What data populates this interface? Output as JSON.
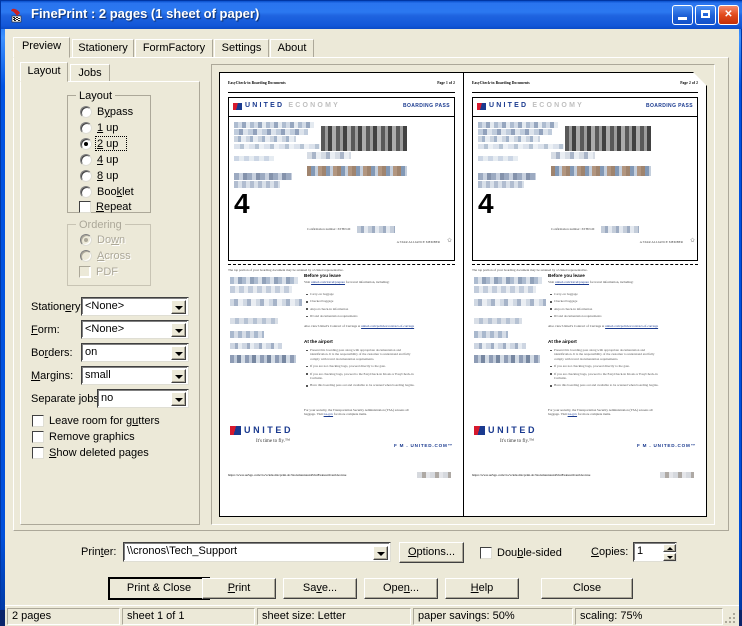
{
  "window": {
    "title": "FinePrint : 2 pages (1 sheet of paper)",
    "icon": "fineprint-icon",
    "minimize_label": "Minimize",
    "maximize_label": "Maximize",
    "close_label": "Close"
  },
  "tabs": [
    {
      "label": "Preview",
      "selected": true
    },
    {
      "label": "Stationery",
      "selected": false
    },
    {
      "label": "FormFactory",
      "selected": false
    },
    {
      "label": "Settings",
      "selected": false
    },
    {
      "label": "About",
      "selected": false
    }
  ],
  "subtabs": [
    {
      "label": "Layout",
      "selected": true
    },
    {
      "label": "Jobs",
      "selected": false
    }
  ],
  "layout_group": {
    "title": "Layout",
    "options": [
      {
        "label": "Bypass",
        "accel": "y",
        "selected": false
      },
      {
        "label": "1 up",
        "accel": "1",
        "selected": false
      },
      {
        "label": "2 up",
        "accel": "2",
        "selected": true,
        "focused": true
      },
      {
        "label": "4 up",
        "accel": "4",
        "selected": false
      },
      {
        "label": "8 up",
        "accel": "8",
        "selected": false
      },
      {
        "label": "Booklet",
        "accel": "k",
        "selected": false
      }
    ],
    "repeat": {
      "label": "Repeat",
      "accel": "R",
      "checked": false
    }
  },
  "ordering_group": {
    "title": "Ordering",
    "enabled": false,
    "options": [
      {
        "label": "Down",
        "accel": "w",
        "selected": true
      },
      {
        "label": "Across",
        "accel": "A",
        "selected": false
      }
    ],
    "pdf": {
      "label": "PDF",
      "checked": false
    }
  },
  "fields": [
    {
      "label": "Stationery:",
      "accel": "e",
      "value": "<None>",
      "name": "stationery-combo"
    },
    {
      "label": "Form:",
      "accel": "F",
      "value": "<None>",
      "name": "form-combo"
    },
    {
      "label": "Borders:",
      "accel": "r",
      "value": "on",
      "name": "borders-combo"
    },
    {
      "label": "Margins:",
      "accel": "M",
      "value": "small",
      "name": "margins-combo"
    },
    {
      "label": "Separate jobs:",
      "accel": "j",
      "value": "no",
      "name": "separate-jobs-combo"
    }
  ],
  "checkboxes": [
    {
      "label": "Leave room for gutters",
      "accel": "t",
      "checked": false,
      "name": "leave-room-for-gutters-checkbox"
    },
    {
      "label": "Remove graphics",
      "accel": "g",
      "checked": false,
      "name": "remove-graphics-checkbox"
    },
    {
      "label": "Show deleted pages",
      "accel": "S",
      "checked": false,
      "name": "show-deleted-pages-checkbox"
    }
  ],
  "printer": {
    "label": "Printer:",
    "accel": "t",
    "value": "\\\\cronos\\Tech_Support",
    "options_label": "Options...",
    "options_accel": "O",
    "double_sided": {
      "label": "Double-sided",
      "accel": "b",
      "checked": false
    },
    "copies_label": "Copies:",
    "copies_accel": "C",
    "copies_value": "1"
  },
  "buttons": [
    {
      "label": "Print & Close",
      "default": true,
      "name": "print-and-close-button"
    },
    {
      "label": "Print",
      "accel": "P",
      "default": false,
      "name": "print-button"
    },
    {
      "label": "Save...",
      "accel": "v",
      "default": false,
      "name": "save-button"
    },
    {
      "label": "Open...",
      "accel": "n",
      "default": false,
      "name": "open-button"
    },
    {
      "label": "Help",
      "accel": "H",
      "default": false,
      "name": "help-button"
    },
    {
      "label": "Close",
      "default": false,
      "name": "close-button"
    }
  ],
  "statusbar": [
    {
      "text": "2 pages",
      "name": "status-pages"
    },
    {
      "text": "sheet 1 of 1",
      "name": "status-sheet"
    },
    {
      "text": "sheet size: Letter",
      "name": "status-sheet-size"
    },
    {
      "text": "paper savings: 50%",
      "name": "status-paper-savings"
    },
    {
      "text": "scaling: 75%",
      "name": "status-scaling"
    }
  ],
  "preview_page": {
    "header_left": "EasyCheck-in Boarding Documents",
    "header_right": "Page 1 of 2",
    "brand": "UNITED",
    "brand_sub": "ECONOMY",
    "boarding_pass_tag": "BOARDING PASS",
    "big_number": "4",
    "confirmation": "Confirmation number: XTHJLM",
    "star_alliance": "A STAR ALLIANCE MEMBER",
    "detach_note": "The top portion of your boarding document may be retained by a United representative.",
    "section1_title": "Before you leave",
    "section1_intro": "Visit united.com/travel/prepare for travel information, including:",
    "section1_items": [
      "Carry-on baggage",
      "Checked baggage",
      "Airport check-in information",
      "ID and documentation requirements"
    ],
    "section1_note": "Also view United's Contract of Carriage at united.com/policies/contract-of-carriage",
    "section2_title": "At the airport",
    "section2_items": [
      "Present this boarding pass along with appropriate documentation and identification. It is the responsibility of the customer to understand and fully comply with travel documentation requirements.",
      "If you are not checking bags, proceed directly to the gate.",
      "If you are checking bags, proceed to the EasyCheck-in Kiosk or EasyCheck-in Curbside.",
      "Have this boarding pass out and available to be scanned when boarding begins."
    ],
    "section2_note": "For your security, the Transportation Security Administration (TSA) screens all baggage. Visit tsa.gov for more complete items.",
    "footer_brand": "UNITED",
    "footer_tagline": "It's time to fly.™",
    "footer_dotcom": "F M .  UNITED.COM™",
    "footer_url": "https://www.uaSgo.com/cto/vclelsoldo/print.do?documentAutoPrintFeatureOverride=true"
  },
  "preview_page_right": {
    "header_right": "Page 2 of 2"
  },
  "colors": {
    "title_blue": "#1257d8",
    "face": "#ece9d8",
    "united_blue": "#1a3a8f",
    "united_red": "#d7192d"
  }
}
